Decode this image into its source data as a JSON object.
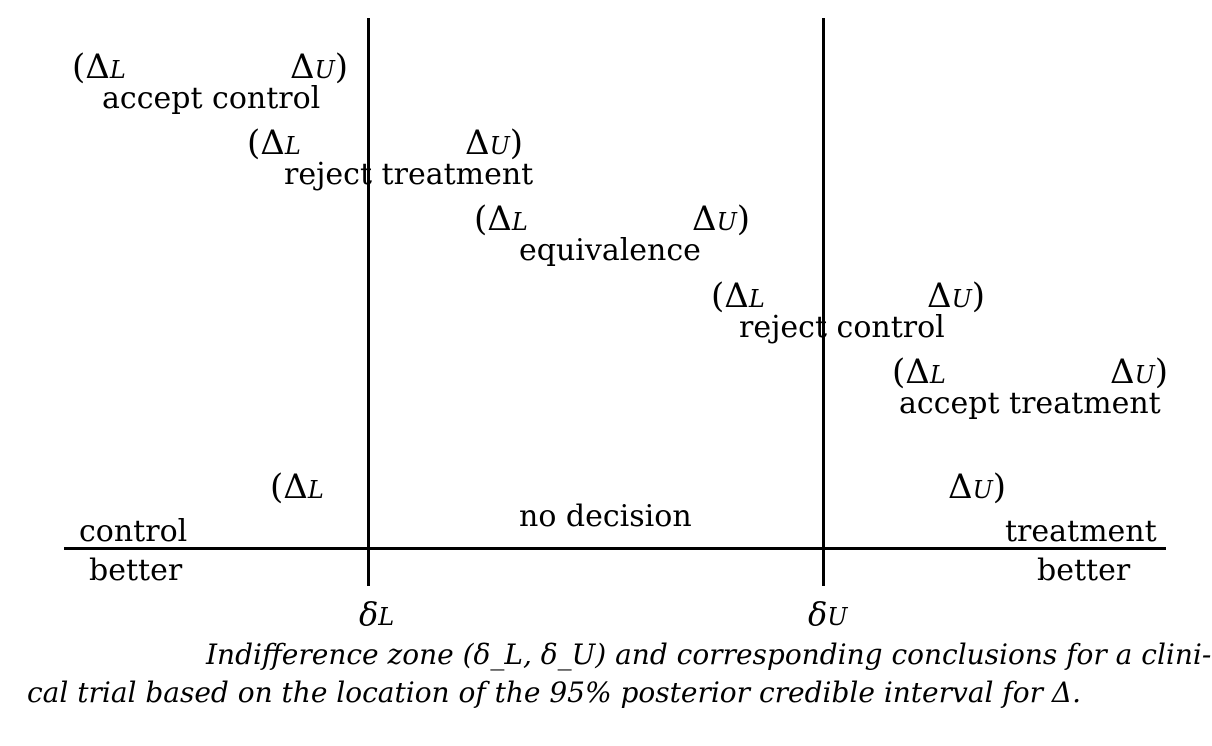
{
  "rows": [
    {
      "open": "(",
      "left_sym": "Δ",
      "left_sub": "L",
      "right_sym": "Δ",
      "right_sub": "U",
      "close": ")",
      "label": "accept control"
    },
    {
      "open": "(",
      "left_sym": "Δ",
      "left_sub": "L",
      "right_sym": "Δ",
      "right_sub": "U",
      "close": ")",
      "label": "reject treatment"
    },
    {
      "open": "(",
      "left_sym": "Δ",
      "left_sub": "L",
      "right_sym": "Δ",
      "right_sub": "U",
      "close": ")",
      "label": "equivalence"
    },
    {
      "open": "(",
      "left_sym": "Δ",
      "left_sub": "L",
      "right_sym": "Δ",
      "right_sub": "U",
      "close": ")",
      "label": "reject control"
    },
    {
      "open": "(",
      "left_sym": "Δ",
      "left_sub": "L",
      "right_sym": "Δ",
      "right_sub": "U",
      "close": ")",
      "label": "accept treatment"
    },
    {
      "open": "(",
      "left_sym": "Δ",
      "left_sub": "L",
      "right_sym": "Δ",
      "right_sub": "U",
      "close": ")",
      "label": "no decision"
    }
  ],
  "axis": {
    "left_top": "control",
    "left_bottom": "better",
    "right_top": "treatment",
    "right_bottom": "better",
    "lower_bound_sym": "δ",
    "lower_bound_sub": "L",
    "upper_bound_sym": "δ",
    "upper_bound_sub": "U"
  },
  "caption": {
    "line1": "Indifference zone (δ_L, δ_U) and corresponding conclusions for a clini-",
    "line2": "cal trial based on the location of the 95% posterior credible interval for Δ."
  }
}
